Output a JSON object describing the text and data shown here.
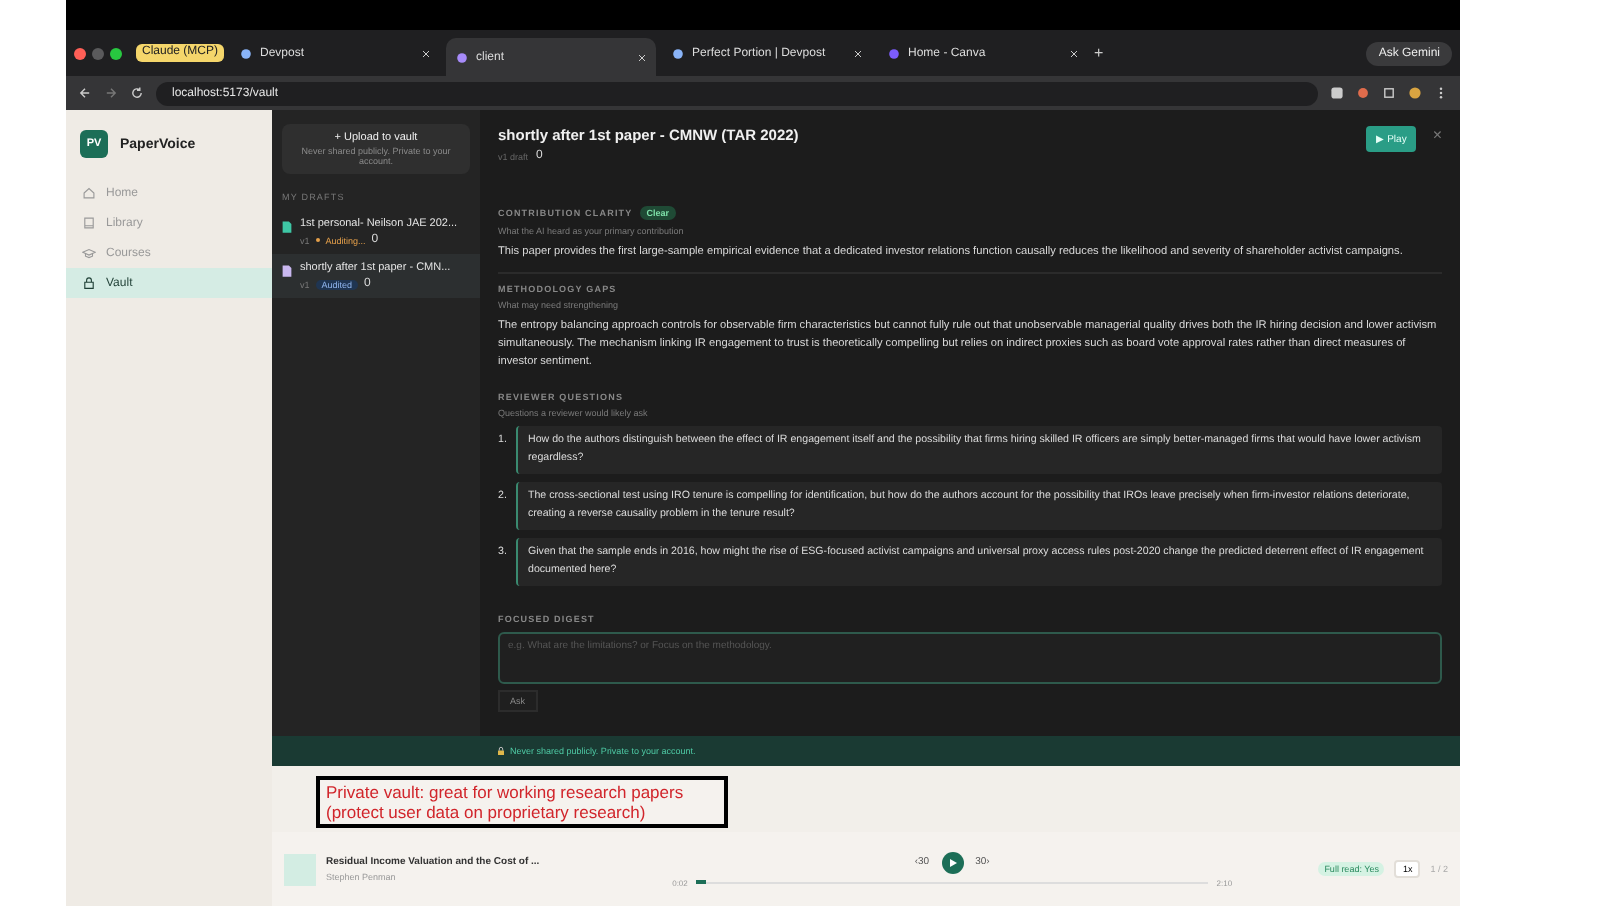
{
  "browser": {
    "tab_group": "Claude (MCP)",
    "tabs": [
      {
        "label": "Devpost",
        "selected": false,
        "kind": "devpost"
      },
      {
        "label": "client",
        "selected": true,
        "kind": "bolt"
      },
      {
        "label": "Perfect Portion | Devpost",
        "selected": false,
        "kind": "devpost"
      },
      {
        "label": "Home - Canva",
        "selected": false,
        "kind": "canva"
      }
    ],
    "new_tab": "+",
    "ask_button": "Ask Gemini",
    "address": "localhost:5173/vault"
  },
  "sidebar": {
    "logo": "PV",
    "brand": "PaperVoice",
    "items": [
      {
        "label": "Home",
        "selected": false,
        "kind": "home"
      },
      {
        "label": "Library",
        "selected": false,
        "kind": "library"
      },
      {
        "label": "Courses",
        "selected": false,
        "kind": "courses"
      },
      {
        "label": "Vault",
        "selected": true,
        "kind": "vault"
      }
    ]
  },
  "drafts": {
    "upload_button": "+ Upload to vault",
    "upload_note": "Never shared publicly. Private to your account.",
    "heading": "MY DRAFTS",
    "items": [
      {
        "title": "1st personal- Neilson JAE 202...",
        "version": "v1",
        "status": "Auditing...",
        "kind": "auditing",
        "count": "0",
        "selected": false
      },
      {
        "title": "shortly after 1st paper - CMN...",
        "version": "v1",
        "status": "Audited",
        "kind": "audited",
        "count": "0",
        "selected": true
      }
    ]
  },
  "document": {
    "title": "shortly after 1st paper - CMNW (TAR 2022)",
    "meta": "v1 draft",
    "count": "0",
    "play_button": "▶ Play",
    "close": "×",
    "contribution": {
      "heading": "CONTRIBUTION CLARITY",
      "badge": "Clear",
      "hint": "What the AI heard as your primary contribution",
      "body": "This paper provides the first large-sample empirical evidence that a dedicated investor relations function causally reduces the likelihood and severity of shareholder activist campaigns."
    },
    "methodology": {
      "heading": "METHODOLOGY GAPS",
      "hint": "What may need strengthening",
      "body": "The entropy balancing approach controls for observable firm characteristics but cannot fully rule out that unobservable managerial quality drives both the IR hiring decision and lower activism simultaneously. The mechanism linking IR engagement to trust is theoretically compelling but relies on indirect proxies such as board vote approval rates rather than direct measures of investor sentiment."
    },
    "questions": {
      "heading": "REVIEWER QUESTIONS",
      "hint": "Questions a reviewer would likely ask",
      "items": [
        {
          "number": "1.",
          "text": "How do the authors distinguish between the effect of IR engagement itself and the possibility that firms hiring skilled IR officers are simply better-managed firms that would have lower activism regardless?"
        },
        {
          "number": "2.",
          "text": "The cross-sectional test using IRO tenure is compelling for identification, but how do the authors account for the possibility that IROs leave precisely when firm-investor relations deteriorate, creating a reverse causality problem in the tenure result?"
        },
        {
          "number": "3.",
          "text": "Given that the sample ends in 2016, how might the rise of ESG-focused activist campaigns and universal proxy access rules post-2020 change the predicted deterrent effect of IR engagement documented here?"
        }
      ]
    },
    "digest": {
      "heading": "FOCUSED DIGEST",
      "placeholder": "e.g. What are the limitations? or Focus on the methodology.",
      "ask_button": "Ask"
    },
    "privacy_note": "Never shared publicly. Private to your account."
  },
  "annotation": "Private vault: great for working research papers (protect user data on proprietary research)",
  "player": {
    "title": "Residual Income Valuation and the Cost of ...",
    "author": "Stephen Penman",
    "back": "‹30",
    "forward": "30›",
    "current_time": "0:02",
    "total_time": "2:10",
    "level": 0.02,
    "full_read": "Full read: Yes",
    "speed": "1x",
    "pages": "1 / 2"
  }
}
